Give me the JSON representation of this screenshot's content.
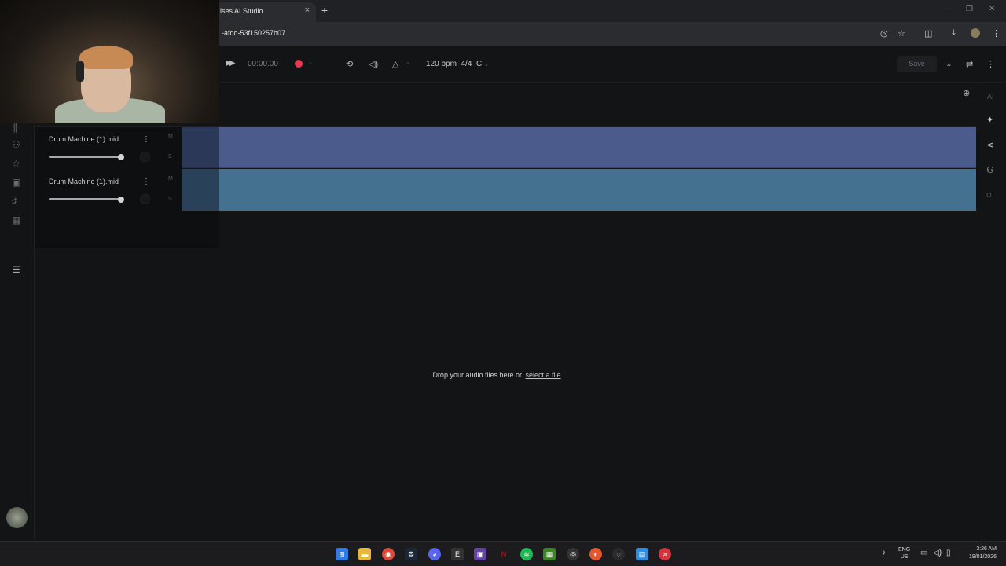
{
  "browser": {
    "tab_title": "ises AI Studio",
    "tab_close": "×",
    "new_tab": "+",
    "url": "-afdd-53f150257b07",
    "window_controls": [
      "—",
      "❐",
      "✕"
    ]
  },
  "toolbar": {
    "play_icon": "▶▶",
    "time": "00:00.00",
    "bpm_label": "120 bpm",
    "time_signature": "4/4",
    "key": "C",
    "save_label": "Save"
  },
  "right_panel": {
    "ai_label": "AI"
  },
  "tracks": [
    {
      "name": "Drum Machine (1).mid",
      "mute": "M",
      "solo": "S",
      "volume": 1.0,
      "color": "#4b5c8c"
    },
    {
      "name": "Drum Machine (1).mid",
      "mute": "M",
      "solo": "S",
      "volume": 1.0,
      "color": "#44718f"
    }
  ],
  "dropzone": {
    "text": "Drop your audio files here or",
    "link": "select a file"
  },
  "taskbar": {
    "lang_line1": "ENG",
    "lang_line2": "US",
    "time": "3:26 AM",
    "date": "19/01/2026"
  },
  "colors": {
    "record": "#e23b4e",
    "lane1": "#4b5c8c",
    "lane2": "#44718f",
    "background": "#131416"
  }
}
